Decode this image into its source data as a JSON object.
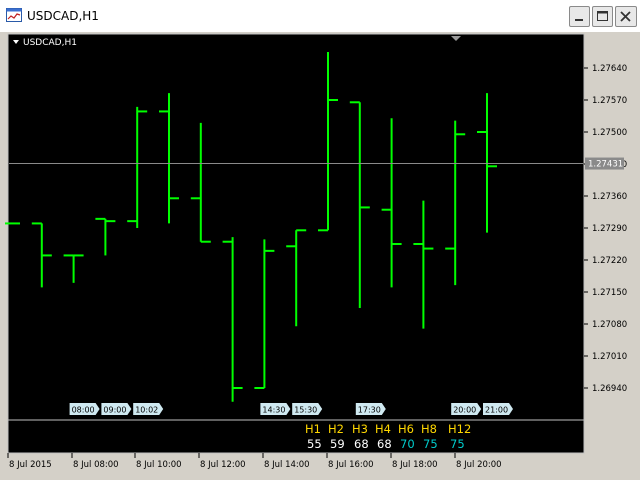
{
  "window": {
    "title": "USDCAD,H1",
    "app_icon": "chart-window-icon",
    "buttons": [
      "minimize-icon",
      "maximize-icon",
      "close-icon"
    ]
  },
  "chart_label": "USDCAD,H1",
  "chart_data": {
    "type": "ohlc",
    "symbol": "USDCAD",
    "timeframe": "H1",
    "background": "#000000",
    "bar_color": "#00ff00",
    "grid": false,
    "price_labels": [
      "1.27640",
      "1.27570",
      "1.27500",
      "1.27430",
      "1.27360",
      "1.27290",
      "1.27220",
      "1.27150",
      "1.27080",
      "1.27010",
      "1.26940"
    ],
    "current_price": "1.27431",
    "bars": [
      {
        "o": 1.273,
        "h": 1.273,
        "l": 1.273,
        "c": 1.273
      },
      {
        "o": 1.273,
        "h": 1.273,
        "l": 1.2716,
        "c": 1.2723
      },
      {
        "o": 1.2723,
        "h": 1.2723,
        "l": 1.2717,
        "c": 1.2723
      },
      {
        "o": 1.2731,
        "h": 1.2731,
        "l": 1.2723,
        "c": 1.27305
      },
      {
        "o": 1.27305,
        "h": 1.27555,
        "l": 1.2729,
        "c": 1.27545
      },
      {
        "o": 1.27545,
        "h": 1.27585,
        "l": 1.273,
        "c": 1.27355
      },
      {
        "o": 1.27355,
        "h": 1.2752,
        "l": 1.2726,
        "c": 1.2726
      },
      {
        "o": 1.2726,
        "h": 1.2727,
        "l": 1.2691,
        "c": 1.2694
      },
      {
        "o": 1.2694,
        "h": 1.27265,
        "l": 1.2694,
        "c": 1.2724
      },
      {
        "o": 1.2725,
        "h": 1.27285,
        "l": 1.27075,
        "c": 1.27285
      },
      {
        "o": 1.27285,
        "h": 1.27675,
        "l": 1.27285,
        "c": 1.2757
      },
      {
        "o": 1.27565,
        "h": 1.27565,
        "l": 1.27115,
        "c": 1.27335
      },
      {
        "o": 1.2733,
        "h": 1.2753,
        "l": 1.2716,
        "c": 1.27255
      },
      {
        "o": 1.27255,
        "h": 1.2735,
        "l": 1.2707,
        "c": 1.27245
      },
      {
        "o": 1.27245,
        "h": 1.27525,
        "l": 1.27165,
        "c": 1.27495
      },
      {
        "o": 1.275,
        "h": 1.27585,
        "l": 1.2728,
        "c": 1.27425
      }
    ],
    "session_labels": [
      {
        "bar": 2,
        "text": "08:00"
      },
      {
        "bar": 3,
        "text": "09:00"
      },
      {
        "bar": 4,
        "text": "10:02"
      },
      {
        "bar": 8,
        "text": "14:30"
      },
      {
        "bar": 9,
        "text": "15:30"
      },
      {
        "bar": 11,
        "text": "17:30"
      },
      {
        "bar": 14,
        "text": "20:00"
      },
      {
        "bar": 15,
        "text": "21:00"
      }
    ],
    "indicator": {
      "headers": [
        "H1",
        "H2",
        "H3",
        "H4",
        "H6",
        "H8",
        "H12"
      ],
      "values": [
        "55",
        "59",
        "68",
        "68",
        "70",
        "75",
        "75"
      ],
      "value_colors": [
        "#ffffff",
        "#ffffff",
        "#ffffff",
        "#ffffff",
        "#00cccc",
        "#00cccc",
        "#00cccc"
      ],
      "header_color": "#ffd700"
    },
    "time_labels": [
      "8 Jul 2015",
      "8 Jul 08:00",
      "8 Jul 10:00",
      "8 Jul 12:00",
      "8 Jul 14:00",
      "8 Jul 16:00",
      "8 Jul 18:00",
      "8 Jul 20:00"
    ]
  }
}
